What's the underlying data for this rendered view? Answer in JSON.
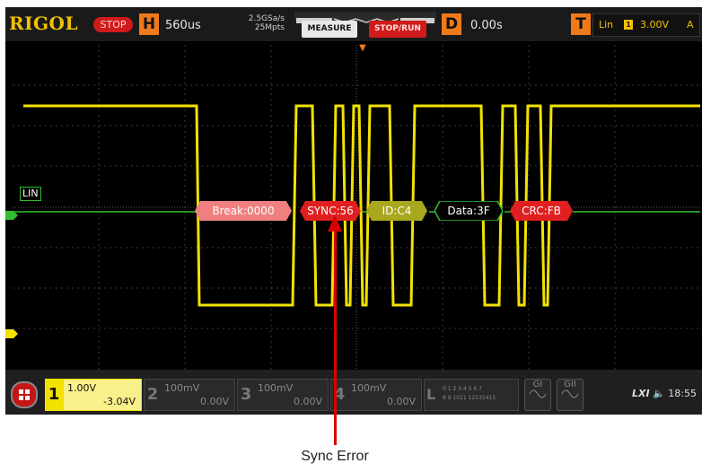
{
  "brand": {
    "logo": "RIGOL",
    "state": "STOP"
  },
  "timebase": {
    "tag": "H",
    "value": "560us",
    "sample_rate": "2.5GSa/s",
    "memory_depth": "25Mpts"
  },
  "buttons": {
    "measure": "MEASURE",
    "stop_run": "STOP/RUN"
  },
  "delay": {
    "tag": "D",
    "value": "0.00s"
  },
  "trigger": {
    "tag": "T",
    "type": "Lin",
    "source": "1",
    "level": "3.00V",
    "mode": "A"
  },
  "bus": {
    "label": "LIN"
  },
  "decode": [
    {
      "text": "Break:0000",
      "color": "#f08080"
    },
    {
      "text": "SYNC:56",
      "color": "#e02020"
    },
    {
      "text": "ID:C4",
      "color": "#a8a81e"
    },
    {
      "text": "Data:3F",
      "color": "#ffffff"
    },
    {
      "text": "CRC:FB",
      "color": "#e02020"
    }
  ],
  "channels": [
    {
      "num": "1",
      "scale": "1.00V",
      "offset": "-3.04V",
      "active": true
    },
    {
      "num": "2",
      "scale": "100mV",
      "offset": "0.00V",
      "active": false
    },
    {
      "num": "3",
      "scale": "100mV",
      "offset": "0.00V",
      "active": false
    },
    {
      "num": "4",
      "scale": "100mV",
      "offset": "0.00V",
      "active": false
    }
  ],
  "logic": {
    "letter": "L",
    "row1": "0 1 2 3  4 5 6 7",
    "row2": "8 9 1011 12131415"
  },
  "generators": [
    {
      "label": "GI"
    },
    {
      "label": "GII"
    }
  ],
  "status": {
    "lxi": "LXI",
    "speaker": "\u0001",
    "time": "18:55"
  },
  "annotation": {
    "text": "Sync Error"
  },
  "colors": {
    "signal": "#f2e200",
    "bus_line": "#2fbf2f",
    "accent": "#f07a1a",
    "error": "#d90000"
  }
}
